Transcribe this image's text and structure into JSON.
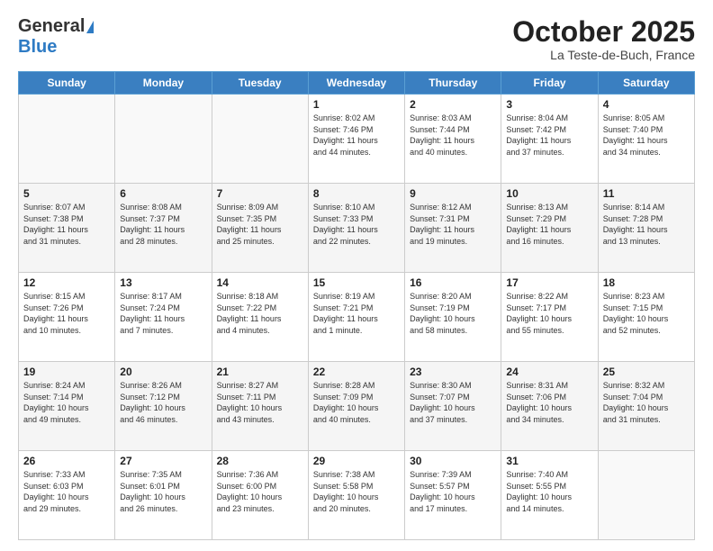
{
  "logo": {
    "general": "General",
    "blue": "Blue"
  },
  "title": "October 2025",
  "location": "La Teste-de-Buch, France",
  "days_of_week": [
    "Sunday",
    "Monday",
    "Tuesday",
    "Wednesday",
    "Thursday",
    "Friday",
    "Saturday"
  ],
  "weeks": [
    [
      {
        "day": "",
        "info": ""
      },
      {
        "day": "",
        "info": ""
      },
      {
        "day": "",
        "info": ""
      },
      {
        "day": "1",
        "info": "Sunrise: 8:02 AM\nSunset: 7:46 PM\nDaylight: 11 hours\nand 44 minutes."
      },
      {
        "day": "2",
        "info": "Sunrise: 8:03 AM\nSunset: 7:44 PM\nDaylight: 11 hours\nand 40 minutes."
      },
      {
        "day": "3",
        "info": "Sunrise: 8:04 AM\nSunset: 7:42 PM\nDaylight: 11 hours\nand 37 minutes."
      },
      {
        "day": "4",
        "info": "Sunrise: 8:05 AM\nSunset: 7:40 PM\nDaylight: 11 hours\nand 34 minutes."
      }
    ],
    [
      {
        "day": "5",
        "info": "Sunrise: 8:07 AM\nSunset: 7:38 PM\nDaylight: 11 hours\nand 31 minutes."
      },
      {
        "day": "6",
        "info": "Sunrise: 8:08 AM\nSunset: 7:37 PM\nDaylight: 11 hours\nand 28 minutes."
      },
      {
        "day": "7",
        "info": "Sunrise: 8:09 AM\nSunset: 7:35 PM\nDaylight: 11 hours\nand 25 minutes."
      },
      {
        "day": "8",
        "info": "Sunrise: 8:10 AM\nSunset: 7:33 PM\nDaylight: 11 hours\nand 22 minutes."
      },
      {
        "day": "9",
        "info": "Sunrise: 8:12 AM\nSunset: 7:31 PM\nDaylight: 11 hours\nand 19 minutes."
      },
      {
        "day": "10",
        "info": "Sunrise: 8:13 AM\nSunset: 7:29 PM\nDaylight: 11 hours\nand 16 minutes."
      },
      {
        "day": "11",
        "info": "Sunrise: 8:14 AM\nSunset: 7:28 PM\nDaylight: 11 hours\nand 13 minutes."
      }
    ],
    [
      {
        "day": "12",
        "info": "Sunrise: 8:15 AM\nSunset: 7:26 PM\nDaylight: 11 hours\nand 10 minutes."
      },
      {
        "day": "13",
        "info": "Sunrise: 8:17 AM\nSunset: 7:24 PM\nDaylight: 11 hours\nand 7 minutes."
      },
      {
        "day": "14",
        "info": "Sunrise: 8:18 AM\nSunset: 7:22 PM\nDaylight: 11 hours\nand 4 minutes."
      },
      {
        "day": "15",
        "info": "Sunrise: 8:19 AM\nSunset: 7:21 PM\nDaylight: 11 hours\nand 1 minute."
      },
      {
        "day": "16",
        "info": "Sunrise: 8:20 AM\nSunset: 7:19 PM\nDaylight: 10 hours\nand 58 minutes."
      },
      {
        "day": "17",
        "info": "Sunrise: 8:22 AM\nSunset: 7:17 PM\nDaylight: 10 hours\nand 55 minutes."
      },
      {
        "day": "18",
        "info": "Sunrise: 8:23 AM\nSunset: 7:15 PM\nDaylight: 10 hours\nand 52 minutes."
      }
    ],
    [
      {
        "day": "19",
        "info": "Sunrise: 8:24 AM\nSunset: 7:14 PM\nDaylight: 10 hours\nand 49 minutes."
      },
      {
        "day": "20",
        "info": "Sunrise: 8:26 AM\nSunset: 7:12 PM\nDaylight: 10 hours\nand 46 minutes."
      },
      {
        "day": "21",
        "info": "Sunrise: 8:27 AM\nSunset: 7:11 PM\nDaylight: 10 hours\nand 43 minutes."
      },
      {
        "day": "22",
        "info": "Sunrise: 8:28 AM\nSunset: 7:09 PM\nDaylight: 10 hours\nand 40 minutes."
      },
      {
        "day": "23",
        "info": "Sunrise: 8:30 AM\nSunset: 7:07 PM\nDaylight: 10 hours\nand 37 minutes."
      },
      {
        "day": "24",
        "info": "Sunrise: 8:31 AM\nSunset: 7:06 PM\nDaylight: 10 hours\nand 34 minutes."
      },
      {
        "day": "25",
        "info": "Sunrise: 8:32 AM\nSunset: 7:04 PM\nDaylight: 10 hours\nand 31 minutes."
      }
    ],
    [
      {
        "day": "26",
        "info": "Sunrise: 7:33 AM\nSunset: 6:03 PM\nDaylight: 10 hours\nand 29 minutes."
      },
      {
        "day": "27",
        "info": "Sunrise: 7:35 AM\nSunset: 6:01 PM\nDaylight: 10 hours\nand 26 minutes."
      },
      {
        "day": "28",
        "info": "Sunrise: 7:36 AM\nSunset: 6:00 PM\nDaylight: 10 hours\nand 23 minutes."
      },
      {
        "day": "29",
        "info": "Sunrise: 7:38 AM\nSunset: 5:58 PM\nDaylight: 10 hours\nand 20 minutes."
      },
      {
        "day": "30",
        "info": "Sunrise: 7:39 AM\nSunset: 5:57 PM\nDaylight: 10 hours\nand 17 minutes."
      },
      {
        "day": "31",
        "info": "Sunrise: 7:40 AM\nSunset: 5:55 PM\nDaylight: 10 hours\nand 14 minutes."
      },
      {
        "day": "",
        "info": ""
      }
    ]
  ]
}
